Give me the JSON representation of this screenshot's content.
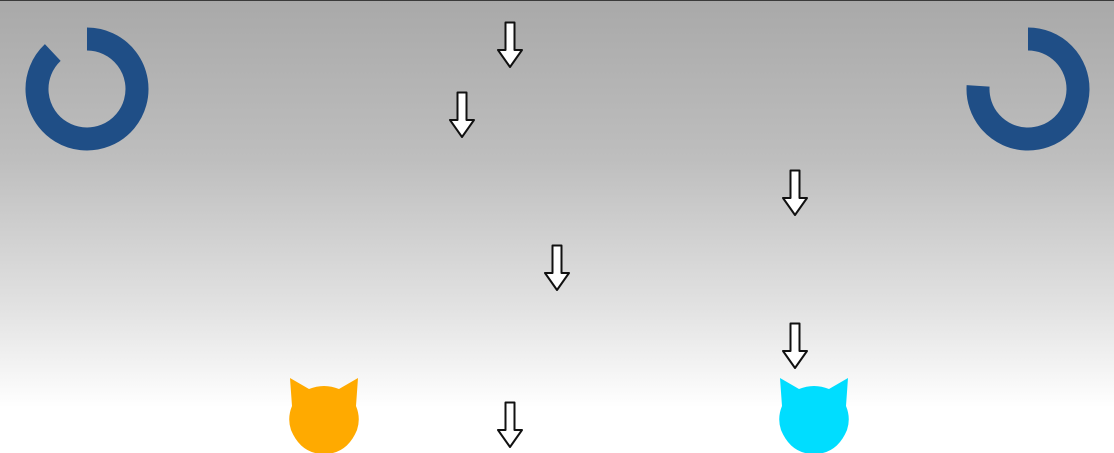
{
  "game": {
    "timers": [
      {
        "id": "left",
        "progress": 0.88,
        "color": "#1f4e86"
      },
      {
        "id": "right",
        "progress": 0.76,
        "color": "#1f4e86"
      }
    ],
    "arrows": {
      "direction": "down",
      "count": 6,
      "fill": "#ffffff",
      "stroke": "#111111"
    },
    "players": [
      {
        "id": "orange",
        "icon": "cat-head-icon",
        "color": "#ffaa00"
      },
      {
        "id": "cyan",
        "icon": "cat-head-icon",
        "color": "#00ddff"
      }
    ],
    "background": {
      "top": "#a9a9a9",
      "bottom": "#ffffff"
    }
  }
}
